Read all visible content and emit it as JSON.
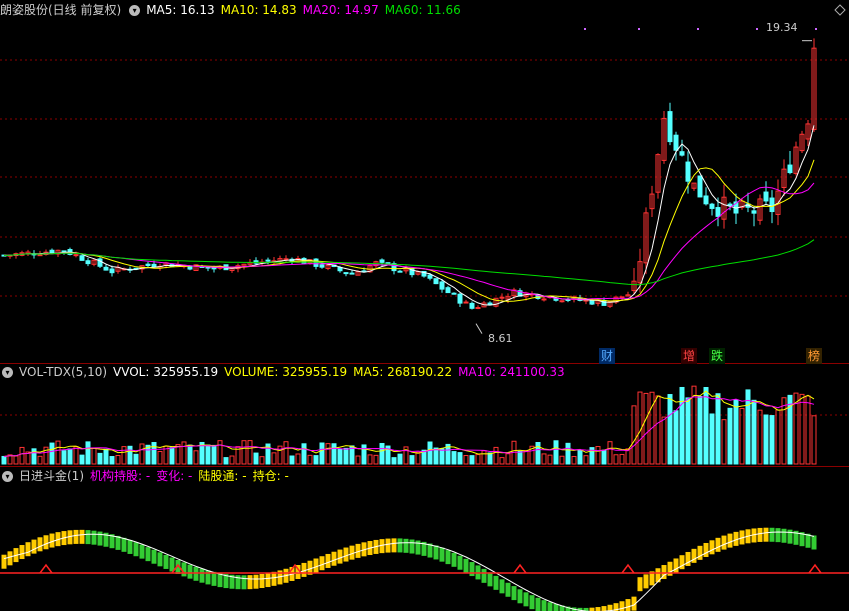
{
  "header": {
    "stock_name": "朗姿股份(日线 前复权)",
    "ma5": "MA5: 16.13",
    "ma10": "MA10: 14.83",
    "ma20": "MA20: 14.97",
    "ma60": "MA60: 11.66"
  },
  "vol_header": {
    "indicator": "VOL-TDX(5,10)",
    "vvol": "VVOL: 325955.19",
    "volume": "VOLUME: 325955.19",
    "ma5": "MA5: 268190.22",
    "ma10": "MA10: 241100.33"
  },
  "ind_header": {
    "indicator": "日进斗金(1)",
    "jigou": "机构持股: -",
    "bianhua": "变化: -",
    "lugutong": "陆股通: -",
    "chicang": "持仓: -"
  },
  "annotations": {
    "high_label": "19.34",
    "low_label": "8.61",
    "event_tags": [
      "财",
      "增",
      "跌",
      "榜"
    ]
  },
  "colors": {
    "up": "#ff3333",
    "down": "#54ffff",
    "ma5": "#ffffff",
    "ma10": "#ffff00",
    "ma20": "#ff00ff",
    "ma60": "#00dd00",
    "grid": "#8b0000",
    "ind_up": "#ffcc00",
    "ind_down": "#33cc33"
  },
  "chart_data": [
    {
      "type": "candlestick",
      "price_range": [
        7.8,
        20.2
      ],
      "high": 19.34,
      "low": 8.61,
      "series": [
        {
          "name": "MA5",
          "value": 16.13
        },
        {
          "name": "MA10",
          "value": 14.83
        },
        {
          "name": "MA20",
          "value": 14.97
        },
        {
          "name": "MA60",
          "value": 11.66
        }
      ]
    },
    {
      "type": "bar",
      "series": [
        {
          "name": "VOLUME",
          "value": 325955.19
        },
        {
          "name": "MA5",
          "value": 268190.22
        },
        {
          "name": "MA10",
          "value": 241100.33
        }
      ]
    },
    {
      "type": "bar",
      "series": [
        {
          "name": "日进斗金",
          "value": null
        }
      ]
    }
  ]
}
